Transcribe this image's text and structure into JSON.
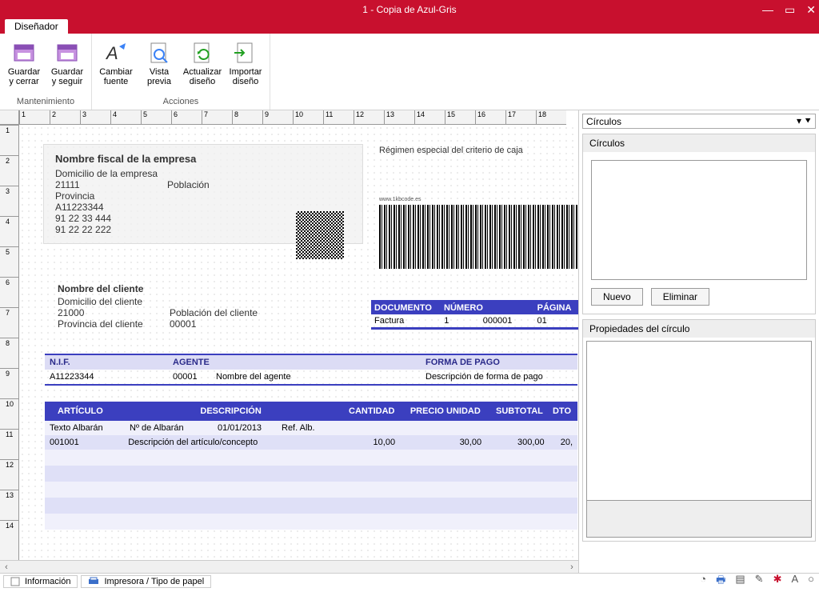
{
  "titlebar": {
    "title": "1 - Copia de Azul-Gris"
  },
  "tabs": {
    "designer": "Diseñador"
  },
  "ribbon": {
    "groups": [
      {
        "label": "Mantenimiento",
        "buttons": [
          {
            "label": "Guardar\ny cerrar"
          },
          {
            "label": "Guardar\ny seguir"
          }
        ]
      },
      {
        "label": "Acciones",
        "buttons": [
          {
            "label": "Cambiar\nfuente"
          },
          {
            "label": "Vista\nprevia"
          },
          {
            "label": "Actualizar\ndiseño"
          },
          {
            "label": "Importar\ndiseño"
          }
        ]
      }
    ]
  },
  "company": {
    "name": "Nombre fiscal de la empresa",
    "address": "Domicilio de la empresa",
    "zip": "21111",
    "city": "Población",
    "province": "Provincia",
    "nif": "A11223344",
    "phone1": "91 22 33 444",
    "phone2": "91 22 22 222"
  },
  "regimen": "Régimen especial del criterio de caja",
  "client": {
    "name": "Nombre del cliente",
    "address": "Domicilio del cliente",
    "zip": "21000",
    "city": "Población del cliente",
    "province": "Provincia del cliente",
    "code": "00001"
  },
  "docinfo": {
    "hdr": {
      "c1": "DOCUMENTO",
      "c2": "NÚMERO",
      "c3": "",
      "c4": "PÁGINA"
    },
    "vals": {
      "c1": "Factura",
      "c2": "1",
      "c3": "000001",
      "c4": "01"
    }
  },
  "nifbar": {
    "hdr": {
      "c1": "N.I.F.",
      "c2": "AGENTE",
      "c3": "",
      "c4": "FORMA DE PAGO"
    },
    "vals": {
      "c1": "A11223344",
      "c2": "00001",
      "c3": "Nombre del agente",
      "c4": "Descripción de forma de pago"
    }
  },
  "items": {
    "hdr": {
      "a1": "ARTÍCULO",
      "a2": "DESCRIPCIÓN",
      "a3": "CANTIDAD",
      "a4": "PRECIO UNIDAD",
      "a5": "SUBTOTAL",
      "a6": "DTO"
    },
    "sub": {
      "a1": "Texto Albarán",
      "a2a": "Nº de Albarán",
      "a2b": "01/01/2013",
      "a2c": "Ref. Alb."
    },
    "row": {
      "a1": "001001",
      "a2": "Descripción del artículo/concepto",
      "a3": "10,00",
      "a4": "30,00",
      "a5": "300,00",
      "a6": "20,"
    }
  },
  "side": {
    "droplabel": "Círculos",
    "sect1": "Círculos",
    "btn_new": "Nuevo",
    "btn_del": "Eliminar",
    "sect2": "Propiedades del círculo"
  },
  "status": {
    "info": "Información",
    "printer": "Impresora / Tipo de papel"
  },
  "ruler_h": [
    "1",
    "2",
    "3",
    "4",
    "5",
    "6",
    "7",
    "8",
    "9",
    "10",
    "11",
    "12",
    "13",
    "14",
    "15",
    "16",
    "17",
    "18"
  ],
  "ruler_v": [
    "1",
    "2",
    "3",
    "4",
    "5",
    "6",
    "7",
    "8",
    "9",
    "10",
    "11",
    "12",
    "13",
    "14"
  ]
}
